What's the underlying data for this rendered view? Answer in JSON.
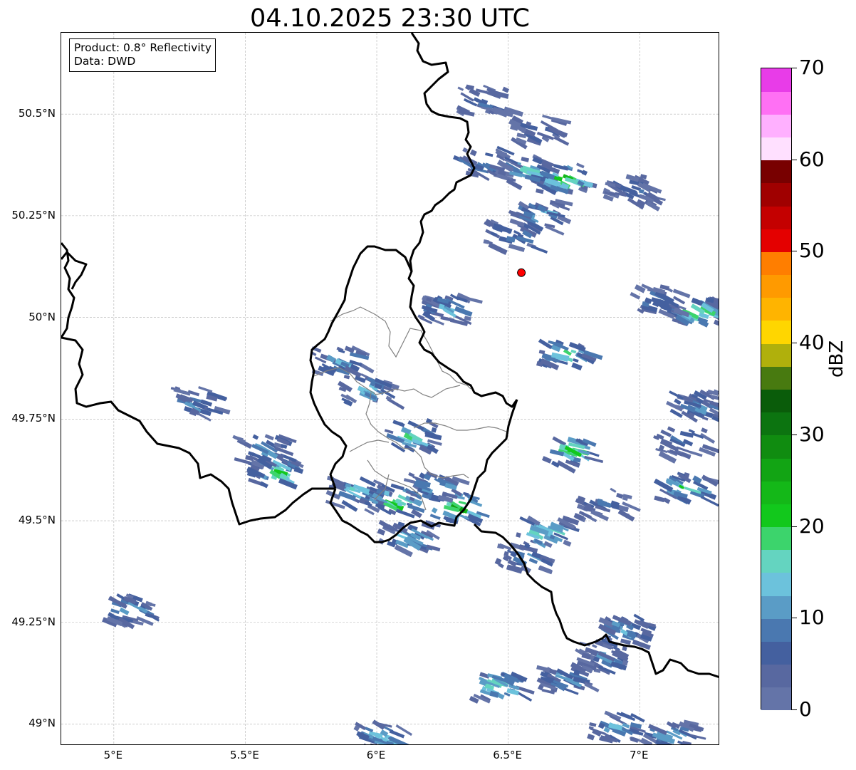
{
  "title": "04.10.2025 23:30 UTC",
  "info": {
    "product": "Product: 0.8° Reflectivity",
    "data": "Data: DWD"
  },
  "map": {
    "lon_range": [
      4.8,
      7.3
    ],
    "lat_range": [
      48.95,
      50.7
    ],
    "lat_ticks": [
      {
        "value": 50.5,
        "label": "50.5°N"
      },
      {
        "value": 50.25,
        "label": "50.25°N"
      },
      {
        "value": 50.0,
        "label": "50°N"
      },
      {
        "value": 49.75,
        "label": "49.75°N"
      },
      {
        "value": 49.5,
        "label": "49.5°N"
      },
      {
        "value": 49.25,
        "label": "49.25°N"
      },
      {
        "value": 49.0,
        "label": "49°N"
      }
    ],
    "lon_ticks": [
      {
        "value": 5.0,
        "label": "5°E"
      },
      {
        "value": 5.5,
        "label": "5.5°E"
      },
      {
        "value": 6.0,
        "label": "6°E"
      },
      {
        "value": 6.5,
        "label": "6.5°E"
      },
      {
        "value": 7.0,
        "label": "7°E"
      }
    ],
    "radar_site": {
      "lon": 6.55,
      "lat": 50.11,
      "color": "#ff0000"
    },
    "border_color": "#000000",
    "canton_color": "#808080",
    "grid": true
  },
  "colorbar": {
    "unit": "dBZ",
    "min": 0,
    "max": 70,
    "step": 2.5,
    "colors": [
      "#6474a8",
      "#5868a0",
      "#44609f",
      "#4a78b0",
      "#5a9cc6",
      "#6cc2dc",
      "#64d4c0",
      "#3cd46c",
      "#12c81c",
      "#14b818",
      "#12a414",
      "#108c10",
      "#0c7410",
      "#0a5c0a",
      "#487a10",
      "#b0b00c",
      "#ffd600",
      "#ffb400",
      "#ff9a00",
      "#ff7e00",
      "#e40000",
      "#c40000",
      "#a00000",
      "#780000",
      "#ffe0ff",
      "#ffb0ff",
      "#ff70f4",
      "#e83ce8"
    ],
    "ticks": [
      {
        "value": 0,
        "label": "0"
      },
      {
        "value": 10,
        "label": "10"
      },
      {
        "value": 20,
        "label": "20"
      },
      {
        "value": 30,
        "label": "30"
      },
      {
        "value": 40,
        "label": "40"
      },
      {
        "value": 50,
        "label": "50"
      },
      {
        "value": 60,
        "label": "60"
      },
      {
        "value": 70,
        "label": "70"
      }
    ]
  },
  "echoes": [
    {
      "lon": 6.38,
      "lat": 50.39,
      "dbz": 12
    },
    {
      "lon": 6.55,
      "lat": 50.37,
      "dbz": 16
    },
    {
      "lon": 6.7,
      "lat": 50.35,
      "dbz": 24
    },
    {
      "lon": 6.95,
      "lat": 50.32,
      "dbz": 10
    },
    {
      "lon": 6.4,
      "lat": 50.54,
      "dbz": 8
    },
    {
      "lon": 6.6,
      "lat": 50.47,
      "dbz": 8
    },
    {
      "lon": 6.6,
      "lat": 50.26,
      "dbz": 14
    },
    {
      "lon": 6.5,
      "lat": 50.21,
      "dbz": 12
    },
    {
      "lon": 7.2,
      "lat": 50.02,
      "dbz": 24
    },
    {
      "lon": 7.05,
      "lat": 50.05,
      "dbz": 10
    },
    {
      "lon": 6.7,
      "lat": 49.92,
      "dbz": 22
    },
    {
      "lon": 5.6,
      "lat": 49.63,
      "dbz": 22
    },
    {
      "lon": 5.55,
      "lat": 49.68,
      "dbz": 12
    },
    {
      "lon": 5.9,
      "lat": 49.58,
      "dbz": 16
    },
    {
      "lon": 6.05,
      "lat": 49.56,
      "dbz": 24
    },
    {
      "lon": 6.3,
      "lat": 49.54,
      "dbz": 28
    },
    {
      "lon": 6.2,
      "lat": 49.59,
      "dbz": 16
    },
    {
      "lon": 6.12,
      "lat": 49.72,
      "dbz": 22
    },
    {
      "lon": 5.95,
      "lat": 49.83,
      "dbz": 14
    },
    {
      "lon": 6.1,
      "lat": 49.47,
      "dbz": 16
    },
    {
      "lon": 6.62,
      "lat": 49.48,
      "dbz": 20
    },
    {
      "lon": 6.55,
      "lat": 49.42,
      "dbz": 10
    },
    {
      "lon": 6.72,
      "lat": 49.68,
      "dbz": 22
    },
    {
      "lon": 7.15,
      "lat": 49.59,
      "dbz": 20
    },
    {
      "lon": 7.15,
      "lat": 49.7,
      "dbz": 10
    },
    {
      "lon": 7.2,
      "lat": 49.79,
      "dbz": 12
    },
    {
      "lon": 5.05,
      "lat": 49.29,
      "dbz": 16
    },
    {
      "lon": 6.92,
      "lat": 49.24,
      "dbz": 14
    },
    {
      "lon": 6.85,
      "lat": 49.17,
      "dbz": 10
    },
    {
      "lon": 6.7,
      "lat": 49.12,
      "dbz": 12
    },
    {
      "lon": 6.45,
      "lat": 49.1,
      "dbz": 22
    },
    {
      "lon": 7.1,
      "lat": 48.98,
      "dbz": 16
    },
    {
      "lon": 5.3,
      "lat": 49.8,
      "dbz": 10
    },
    {
      "lon": 5.85,
      "lat": 49.9,
      "dbz": 12
    },
    {
      "lon": 6.25,
      "lat": 50.03,
      "dbz": 14
    },
    {
      "lon": 6.85,
      "lat": 49.55,
      "dbz": 8
    },
    {
      "lon": 6.9,
      "lat": 49.0,
      "dbz": 14
    },
    {
      "lon": 6.0,
      "lat": 48.98,
      "dbz": 16
    }
  ]
}
